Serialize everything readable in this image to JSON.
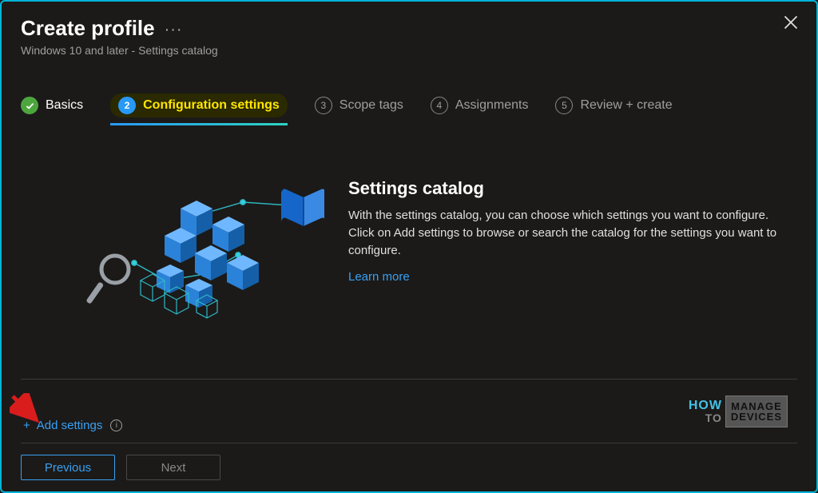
{
  "header": {
    "title": "Create profile",
    "subtitle": "Windows 10 and later - Settings catalog"
  },
  "steps": [
    {
      "num": "1",
      "label": "Basics",
      "state": "done"
    },
    {
      "num": "2",
      "label": "Configuration settings",
      "state": "current"
    },
    {
      "num": "3",
      "label": "Scope tags",
      "state": "pending"
    },
    {
      "num": "4",
      "label": "Assignments",
      "state": "pending"
    },
    {
      "num": "5",
      "label": "Review + create",
      "state": "pending"
    }
  ],
  "main": {
    "heading": "Settings catalog",
    "body": "With the settings catalog, you can choose which settings you want to configure. Click on Add settings to browse or search the catalog for the settings you want to configure.",
    "learn_more": "Learn more"
  },
  "actions": {
    "add_settings": "Add settings",
    "previous": "Previous",
    "next": "Next"
  },
  "watermark": {
    "left1": "HOW",
    "left2": "TO",
    "right1": "MANAGE",
    "right2": "DEVICES"
  }
}
